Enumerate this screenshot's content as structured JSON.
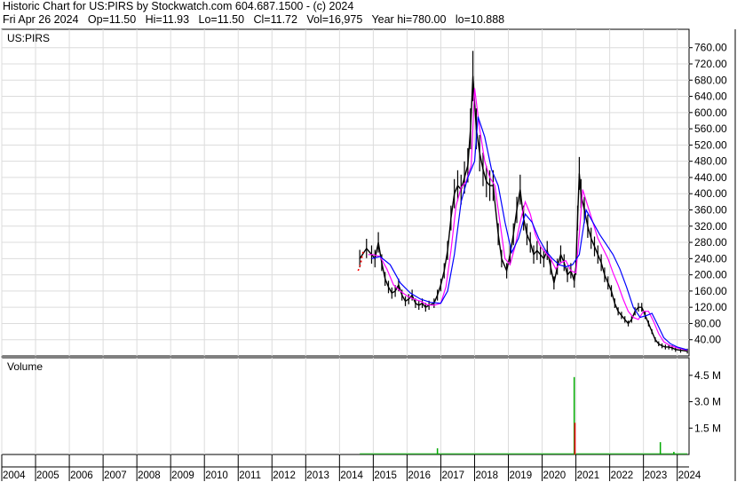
{
  "header": {
    "line1": "Historic Chart for US:PIRS by Stockwatch.com 604.687.1500 - (c) 2024",
    "line2": "Fri Apr 26 2024   Op=11.50   Hi=11.93   Lo=11.50   Cl=11.72   Vol=16,975   Year hi=780.00   lo=10.888"
  },
  "chart_data": [
    {
      "type": "line",
      "title": "US:PIRS",
      "ylim": [
        0,
        790
      ],
      "y_ticks": [
        40,
        80,
        120,
        160,
        200,
        240,
        280,
        320,
        360,
        400,
        440,
        480,
        520,
        560,
        600,
        640,
        680,
        720,
        760
      ],
      "y_tick_labels": [
        "40.00",
        "80.00",
        "120.00",
        "160.00",
        "200.00",
        "240.00",
        "280.00",
        "320.00",
        "360.00",
        "400.00",
        "440.00",
        "480.00",
        "520.00",
        "560.00",
        "600.00",
        "640.00",
        "680.00",
        "720.00",
        "760.00"
      ],
      "x_ticks": [
        "2004",
        "2005",
        "2006",
        "2007",
        "2008",
        "2009",
        "2010",
        "2011",
        "2012",
        "2013",
        "2014",
        "2015",
        "2016",
        "2017",
        "2018",
        "2019",
        "2020",
        "2021",
        "2022",
        "2023",
        "2024"
      ],
      "xlim": [
        2004.0,
        2024.35
      ],
      "grid": true,
      "colors": {
        "price": "#000000",
        "ma_short": "#ff00ff",
        "ma_long": "#0000ff",
        "early": "#ff0000"
      },
      "series": [
        {
          "key": "price",
          "x": [
            2014.6,
            2014.8,
            2014.95,
            2015.05,
            2015.15,
            2015.25,
            2015.35,
            2015.45,
            2015.55,
            2015.65,
            2015.75,
            2015.85,
            2015.95,
            2016.05,
            2016.15,
            2016.25,
            2016.35,
            2016.45,
            2016.55,
            2016.65,
            2016.8,
            2016.9,
            2017.0,
            2017.1,
            2017.2,
            2017.3,
            2017.4,
            2017.5,
            2017.6,
            2017.7,
            2017.8,
            2017.88,
            2017.95,
            2018.05,
            2018.15,
            2018.25,
            2018.35,
            2018.45,
            2018.55,
            2018.7,
            2018.8,
            2018.95,
            2019.05,
            2019.15,
            2019.25,
            2019.35,
            2019.45,
            2019.55,
            2019.65,
            2019.75,
            2019.85,
            2019.95,
            2020.05,
            2020.15,
            2020.25,
            2020.35,
            2020.45,
            2020.55,
            2020.65,
            2020.75,
            2020.85,
            2020.95,
            2021.0,
            2021.05,
            2021.1,
            2021.15,
            2021.25,
            2021.35,
            2021.45,
            2021.55,
            2021.65,
            2021.75,
            2021.85,
            2021.95,
            2022.05,
            2022.15,
            2022.25,
            2022.35,
            2022.45,
            2022.55,
            2022.65,
            2022.75,
            2022.85,
            2022.95,
            2023.05,
            2023.15,
            2023.25,
            2023.35,
            2023.45,
            2023.55,
            2023.65,
            2023.75,
            2023.85,
            2023.95,
            2024.1,
            2024.3
          ],
          "y": [
            240,
            265,
            250,
            240,
            280,
            230,
            190,
            170,
            155,
            160,
            175,
            150,
            135,
            140,
            150,
            130,
            125,
            130,
            120,
            125,
            130,
            150,
            175,
            210,
            260,
            340,
            400,
            420,
            410,
            440,
            470,
            560,
            690,
            560,
            500,
            460,
            430,
            420,
            420,
            300,
            240,
            210,
            250,
            300,
            360,
            410,
            340,
            300,
            280,
            250,
            260,
            250,
            240,
            260,
            220,
            180,
            220,
            250,
            230,
            200,
            210,
            185,
            220,
            340,
            450,
            400,
            360,
            320,
            290,
            270,
            250,
            230,
            200,
            180,
            160,
            130,
            110,
            100,
            90,
            80,
            90,
            110,
            120,
            120,
            100,
            80,
            60,
            40,
            30,
            25,
            22,
            22,
            20,
            16,
            14,
            12
          ]
        },
        {
          "key": "ma_short",
          "x": [
            2014.85,
            2015.0,
            2015.2,
            2015.4,
            2015.6,
            2015.8,
            2016.0,
            2016.2,
            2016.4,
            2016.6,
            2016.8,
            2017.0,
            2017.15,
            2017.3,
            2017.45,
            2017.6,
            2017.75,
            2017.9,
            2018.0,
            2018.15,
            2018.3,
            2018.45,
            2018.6,
            2018.75,
            2018.9,
            2019.05,
            2019.2,
            2019.35,
            2019.5,
            2019.65,
            2019.8,
            2019.95,
            2020.1,
            2020.25,
            2020.4,
            2020.55,
            2020.7,
            2020.85,
            2021.0,
            2021.1,
            2021.2,
            2021.35,
            2021.5,
            2021.65,
            2021.8,
            2021.95,
            2022.1,
            2022.25,
            2022.4,
            2022.55,
            2022.7,
            2022.85,
            2023.0,
            2023.15,
            2023.3,
            2023.45,
            2023.6,
            2023.8,
            2024.0,
            2024.3
          ],
          "y": [
            250,
            250,
            245,
            215,
            175,
            160,
            148,
            140,
            135,
            126,
            125,
            130,
            170,
            260,
            370,
            415,
            430,
            470,
            660,
            560,
            480,
            440,
            420,
            330,
            240,
            225,
            270,
            330,
            380,
            350,
            300,
            270,
            255,
            240,
            215,
            230,
            235,
            210,
            205,
            300,
            410,
            370,
            330,
            290,
            265,
            240,
            205,
            175,
            140,
            110,
            95,
            90,
            110,
            110,
            85,
            55,
            35,
            25,
            20,
            14
          ]
        },
        {
          "key": "ma_long",
          "x": [
            2014.95,
            2015.2,
            2015.5,
            2015.8,
            2016.1,
            2016.4,
            2016.7,
            2017.0,
            2017.2,
            2017.4,
            2017.6,
            2017.8,
            2018.0,
            2018.1,
            2018.3,
            2018.5,
            2018.7,
            2018.9,
            2019.1,
            2019.3,
            2019.5,
            2019.7,
            2019.9,
            2020.1,
            2020.3,
            2020.5,
            2020.7,
            2020.9,
            2021.1,
            2021.3,
            2021.5,
            2021.7,
            2021.9,
            2022.1,
            2022.3,
            2022.5,
            2022.7,
            2022.9,
            2023.1,
            2023.25,
            2023.4,
            2023.6,
            2023.8,
            2024.0,
            2024.3
          ],
          "y": [
            240,
            245,
            225,
            180,
            155,
            140,
            132,
            130,
            160,
            250,
            380,
            440,
            480,
            590,
            540,
            460,
            420,
            330,
            255,
            290,
            350,
            330,
            290,
            260,
            240,
            225,
            220,
            225,
            250,
            360,
            330,
            300,
            275,
            250,
            215,
            170,
            120,
            95,
            100,
            105,
            80,
            45,
            30,
            22,
            15
          ]
        },
        {
          "key": "early",
          "x": [
            2014.55,
            2014.62,
            2014.7
          ],
          "y": [
            210,
            225,
            258
          ]
        }
      ]
    },
    {
      "type": "bar",
      "title": "Volume",
      "ylim": [
        0,
        5500000
      ],
      "y_ticks": [
        1500000,
        3000000,
        4500000
      ],
      "y_tick_labels": [
        "1.5 M",
        "3.0 M",
        "4.5 M"
      ],
      "colors": {
        "volume": "#00aa00",
        "volume_spike": "#ff0000"
      },
      "spikes": [
        {
          "x": 2016.9,
          "value": 350000
        },
        {
          "x": 2020.95,
          "value": 4400000
        },
        {
          "x": 2020.97,
          "value": 1800000,
          "color": "volume_spike"
        },
        {
          "x": 2023.5,
          "value": 700000
        },
        {
          "x": 2023.9,
          "value": 150000
        }
      ],
      "baseline_value": 70000
    }
  ]
}
